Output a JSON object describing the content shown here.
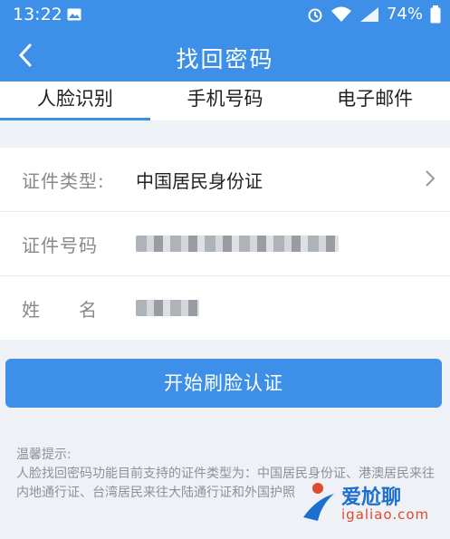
{
  "status_bar": {
    "time": "13:22",
    "battery": "74%",
    "icons": [
      "image-icon",
      "alarm-icon",
      "wifi-icon",
      "signal-icon",
      "battery-icon"
    ]
  },
  "app_bar": {
    "back_icon": "back-arrow-icon",
    "title": "找回密码",
    "color": "#3d8fe8"
  },
  "tabs": [
    {
      "label": "人脸识别",
      "active": true
    },
    {
      "label": "手机号码",
      "active": false
    },
    {
      "label": "电子邮件",
      "active": false
    }
  ],
  "form": {
    "id_type": {
      "label": "证件类型:",
      "value": "中国居民身份证",
      "icon": "chevron-right-icon"
    },
    "id_number": {
      "label": "证件号码",
      "value": ""
    },
    "name": {
      "label": "姓　　名",
      "value": ""
    }
  },
  "start_button": {
    "label": "开始刷脸认证"
  },
  "tips": {
    "title": "温馨提示:",
    "text": "人脸找回密码功能目前支持的证件类型为：中国居民身份证、港澳居民来往内地通行证、台湾居民来往大陆通行证和外国护照"
  },
  "watermark": {
    "text": "爱尬聊",
    "domain": "igaliao.com"
  }
}
